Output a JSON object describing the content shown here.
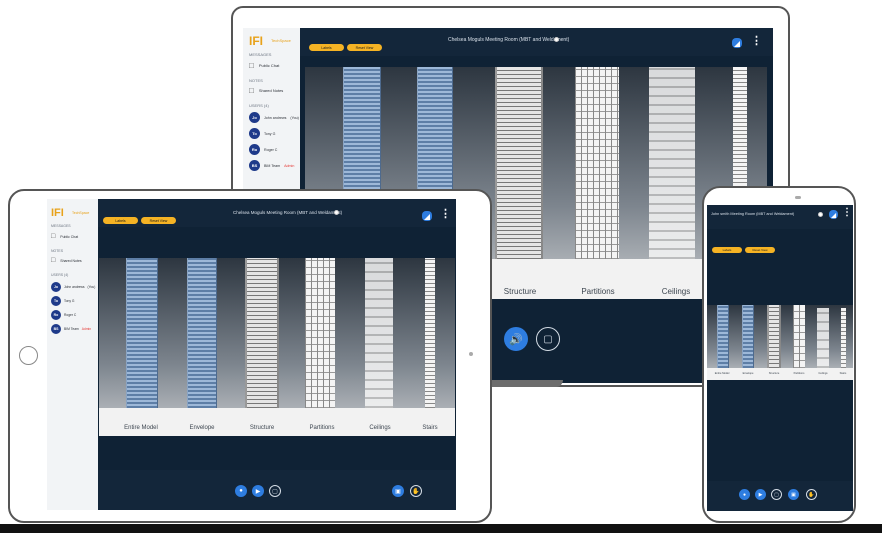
{
  "app": {
    "logo": "IFI",
    "logo_sub": "TechSpace",
    "title": "Chelsea Moguls Meeting Room (MBT and Weldament)",
    "phone_title": "John smith Meeting Room (MBT and Weldament)",
    "pill_one": "Labels",
    "pill_two": "Reset View"
  },
  "sidebar": {
    "messages_heading": "Messages",
    "public_chat": "Public Chat",
    "notes_heading": "Notes",
    "shared_notes": "Shared Notes",
    "users_heading": "Users (4)",
    "users": [
      {
        "initials": "Jo",
        "name": "John andrews",
        "tag": "(You)",
        "sub": ""
      },
      {
        "initials": "To",
        "name": "Tony G",
        "tag": "",
        "sub": ""
      },
      {
        "initials": "Ro",
        "name": "Roger C",
        "tag": "",
        "sub": ""
      },
      {
        "initials": "BS",
        "name": "BIM Team",
        "tag": "",
        "sub": "Admin"
      }
    ]
  },
  "viewer": {
    "labels": [
      "Entire Model",
      "Envelope",
      "Structure",
      "Partitions",
      "Ceilings",
      "Stairs"
    ]
  },
  "colors": {
    "accent": "#2e7de0",
    "brand": "#e8a21a",
    "background": "#0f2235",
    "status": "#e53935"
  },
  "icons": {
    "mic": "microphone-icon",
    "audio": "speaker-icon",
    "camera": "video-off-icon",
    "screen": "screen-share-icon",
    "hand": "raise-hand-icon",
    "signal": "signal-icon",
    "menu": "kebab-menu-icon",
    "record": "record-icon"
  }
}
